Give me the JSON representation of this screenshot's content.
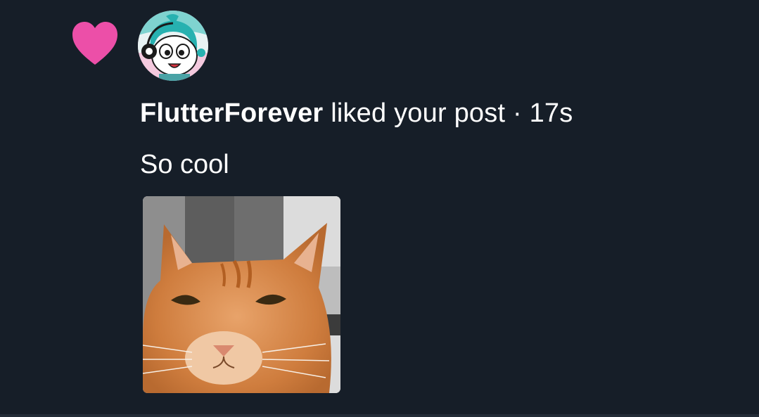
{
  "notification": {
    "icon": "heart-icon",
    "icon_color": "#ec4fa8",
    "username": "FlutterForever",
    "action": "liked your post",
    "separator": "·",
    "time": "17s",
    "comment": "So cool",
    "thumbnail": "orange-cat-photo"
  },
  "colors": {
    "background": "#161e28",
    "text": "#ffffff",
    "accent_heart": "#ec4fa8"
  }
}
